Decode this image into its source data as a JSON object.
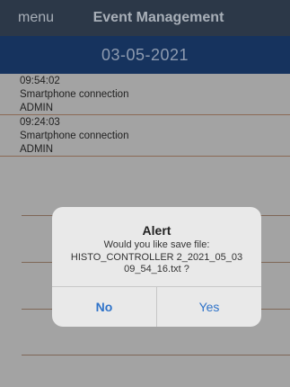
{
  "header": {
    "menu_label": "menu",
    "title": "Event Management"
  },
  "date_bar": {
    "date": "03-05-2021"
  },
  "log": [
    {
      "time": "09:54:02",
      "event": "Smartphone connection",
      "user": "ADMIN"
    },
    {
      "time": "09:24:03",
      "event": "Smartphone connection",
      "user": "ADMIN"
    }
  ],
  "alert": {
    "title": "Alert",
    "message": "Would you like  save file: HISTO_CONTROLLER 2_2021_05_03 09_54_16.txt ?",
    "no_label": "No",
    "yes_label": "Yes"
  },
  "colors": {
    "header_bg": "#2c3848",
    "date_bar_bg": "#16335e",
    "content_bg": "#a3a3a3",
    "accent": "#2f73c9"
  }
}
